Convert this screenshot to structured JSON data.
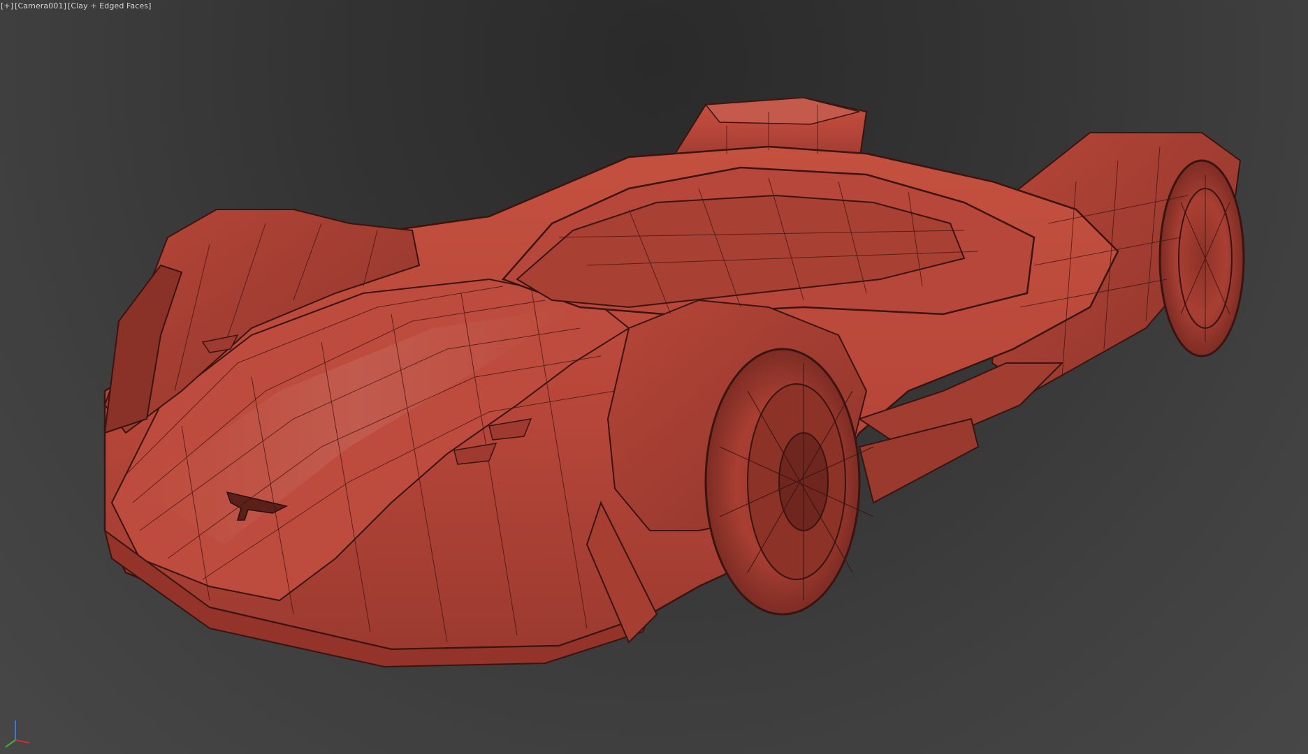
{
  "viewport": {
    "label_plus": "[+]",
    "label_camera": "[Camera001]",
    "label_shading": "[Clay + Edged Faces]"
  },
  "scene": {
    "model": "car-model",
    "model_color": "#b9463b",
    "wire_color": "#3a1410"
  },
  "gizmo": {
    "x_color": "#c8302c",
    "y_color": "#3fb13f",
    "z_color": "#3a7ad8"
  }
}
